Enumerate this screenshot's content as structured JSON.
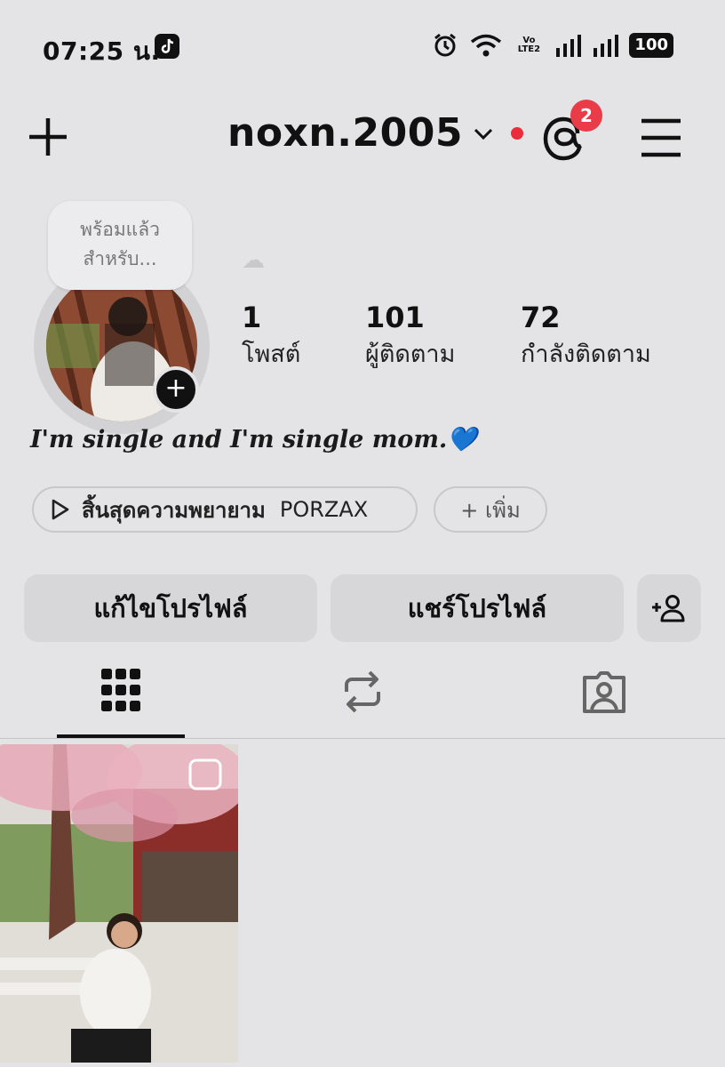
{
  "status_bar": {
    "time": "07:25 น.",
    "app_icon": "tiktok-icon",
    "icons": [
      "alarm-icon",
      "wifi-icon",
      "volte-icon",
      "signal-icon",
      "signal-icon"
    ],
    "volte_text": "Vo LTE2",
    "battery": "100"
  },
  "header": {
    "username": "noxn.2005",
    "threads_badge": "2",
    "plus_icon": "plus-icon",
    "menu_icon": "hamburger-menu-icon"
  },
  "profile": {
    "note": "พร้อมแล้วสำหรับ...",
    "note_line1": "พร้อมแล้ว",
    "note_line2": "สำหรับ...",
    "avatar_add_symbol": "+",
    "cloud": "☁"
  },
  "stats": [
    {
      "value": "1",
      "label": "โพสต์"
    },
    {
      "value": "101",
      "label": "ผู้ติดตาม"
    },
    {
      "value": "72",
      "label": "กำลังติดตาม"
    }
  ],
  "bio": "I'm single and I'm single mom.💙",
  "music": {
    "title": "สิ้นสุดความพยายาม",
    "artist": "PORZAX"
  },
  "add_pill": "+ เพิ่ม",
  "buttons": {
    "edit_profile": "แก้ไขโปรไฟล์",
    "share_profile": "แชร์โปรไฟล์"
  },
  "tabs": [
    "grid-icon",
    "reposts-icon",
    "tagged-icon"
  ],
  "colors": {
    "background": "#e4e4e6",
    "badge_red": "#ea3b48",
    "button_gray": "#d7d7da"
  }
}
